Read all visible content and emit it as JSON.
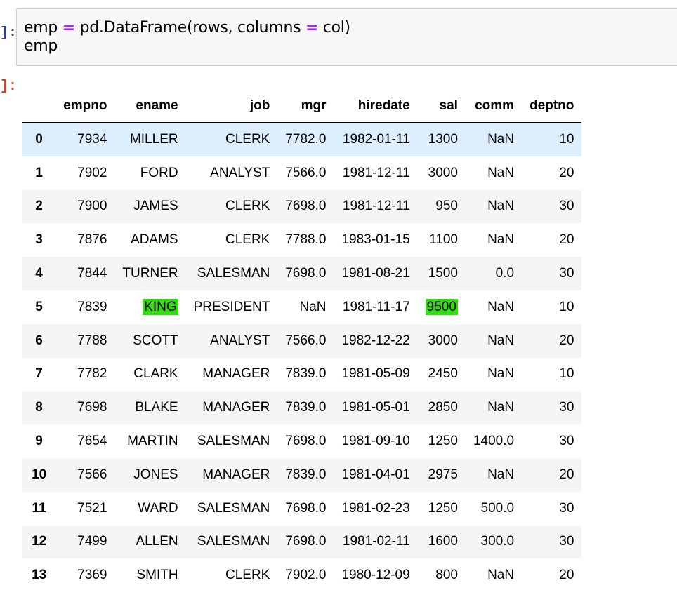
{
  "input_cell": {
    "prompt": "]:",
    "code_line1": {
      "lhs": "emp ",
      "op": "=",
      "mid": " pd.DataFrame(rows, columns ",
      "op2": "=",
      "rhs": " col)"
    },
    "code_line2": "emp"
  },
  "output_cell": {
    "prompt": "]:"
  },
  "table": {
    "columns": [
      "",
      "empno",
      "ename",
      "job",
      "mgr",
      "hiredate",
      "sal",
      "comm",
      "deptno"
    ],
    "rows": [
      [
        "0",
        "7934",
        "MILLER",
        "CLERK",
        "7782.0",
        "1982-01-11",
        "1300",
        "NaN",
        "10"
      ],
      [
        "1",
        "7902",
        "FORD",
        "ANALYST",
        "7566.0",
        "1981-12-11",
        "3000",
        "NaN",
        "20"
      ],
      [
        "2",
        "7900",
        "JAMES",
        "CLERK",
        "7698.0",
        "1981-12-11",
        "950",
        "NaN",
        "30"
      ],
      [
        "3",
        "7876",
        "ADAMS",
        "CLERK",
        "7788.0",
        "1983-01-15",
        "1100",
        "NaN",
        "20"
      ],
      [
        "4",
        "7844",
        "TURNER",
        "SALESMAN",
        "7698.0",
        "1981-08-21",
        "1500",
        "0.0",
        "30"
      ],
      [
        "5",
        "7839",
        "KING",
        "PRESIDENT",
        "NaN",
        "1981-11-17",
        "9500",
        "NaN",
        "10"
      ],
      [
        "6",
        "7788",
        "SCOTT",
        "ANALYST",
        "7566.0",
        "1982-12-22",
        "3000",
        "NaN",
        "20"
      ],
      [
        "7",
        "7782",
        "CLARK",
        "MANAGER",
        "7839.0",
        "1981-05-09",
        "2450",
        "NaN",
        "10"
      ],
      [
        "8",
        "7698",
        "BLAKE",
        "MANAGER",
        "7839.0",
        "1981-05-01",
        "2850",
        "NaN",
        "30"
      ],
      [
        "9",
        "7654",
        "MARTIN",
        "SALESMAN",
        "7698.0",
        "1981-09-10",
        "1250",
        "1400.0",
        "30"
      ],
      [
        "10",
        "7566",
        "JONES",
        "MANAGER",
        "7839.0",
        "1981-04-01",
        "2975",
        "NaN",
        "20"
      ],
      [
        "11",
        "7521",
        "WARD",
        "SALESMAN",
        "7698.0",
        "1981-02-23",
        "1250",
        "500.0",
        "30"
      ],
      [
        "12",
        "7499",
        "ALLEN",
        "SALESMAN",
        "7698.0",
        "1981-02-11",
        "1600",
        "300.0",
        "30"
      ],
      [
        "13",
        "7369",
        "SMITH",
        "CLERK",
        "7902.0",
        "1980-12-09",
        "800",
        "NaN",
        "20"
      ]
    ],
    "hovered_row": 0,
    "highlighted_cells": [
      {
        "row": 5,
        "col": 2
      },
      {
        "row": 5,
        "col": 6
      }
    ],
    "highlight_color": "#33dd11",
    "hover_color": "#ddeeff"
  }
}
